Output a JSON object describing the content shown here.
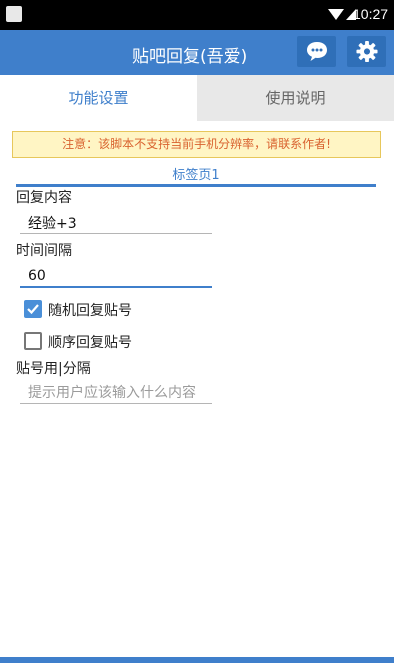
{
  "status_bar": {
    "time": "10:27"
  },
  "app_bar": {
    "title": "贴吧回复(吾爱)",
    "chat_icon": "chat-bubble-icon",
    "settings_icon": "gear-icon"
  },
  "tabs": [
    {
      "label": "功能设置",
      "active": true
    },
    {
      "label": "使用说明",
      "active": false
    }
  ],
  "notice": "注意：该脚本不支持当前手机分辨率，请联系作者!",
  "subtab": "标签页1",
  "form": {
    "reply_label": "回复内容",
    "reply_value": "经验+3",
    "interval_label": "时间间隔",
    "interval_value": "60",
    "random_label": "随机回复贴号",
    "random_checked": true,
    "sequential_label": "顺序回复贴号",
    "sequential_checked": false,
    "ids_label": "贴号用|分隔",
    "ids_placeholder": "提示用户应该输入什么内容"
  },
  "colors": {
    "accent": "#3f7fcb",
    "notice_bg": "#fff5c4",
    "notice_text": "#d9622f"
  }
}
